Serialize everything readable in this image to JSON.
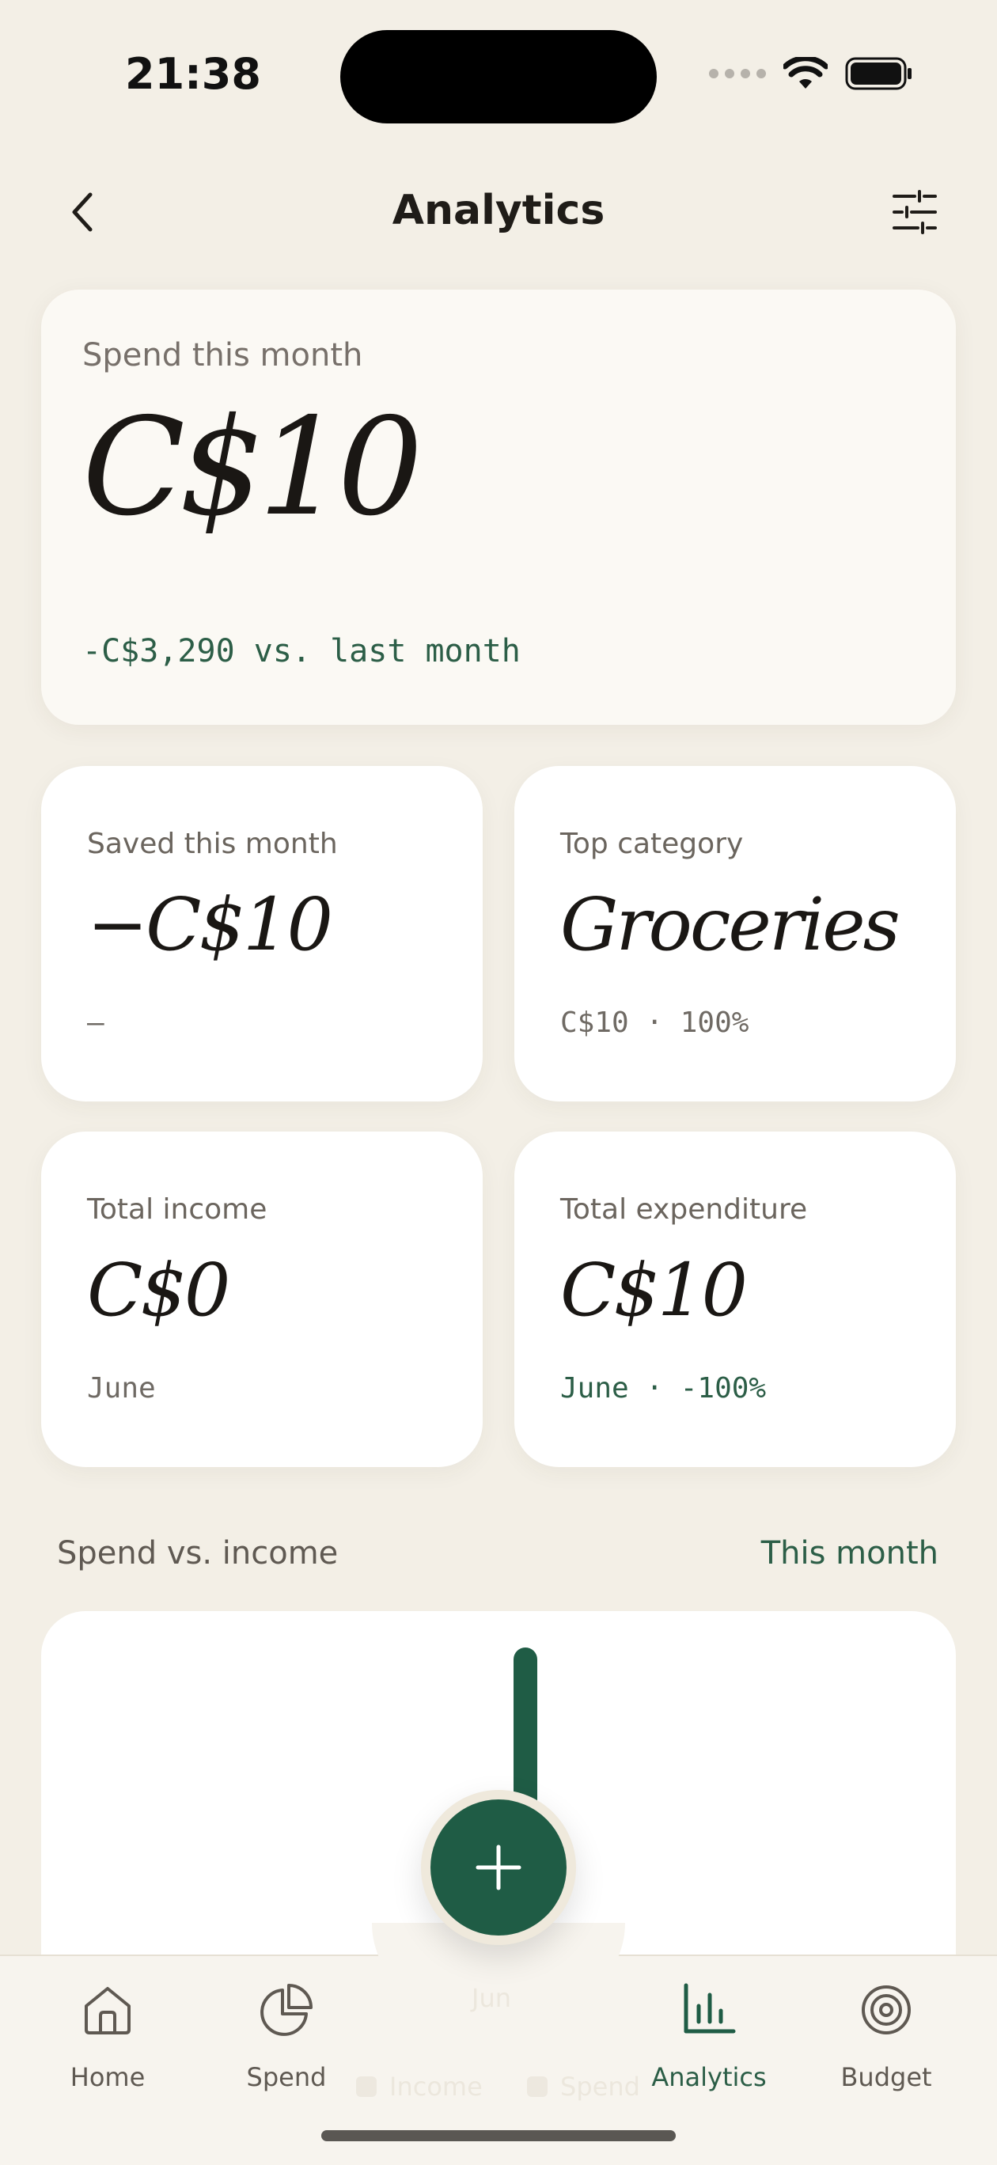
{
  "status_bar": {
    "time": "21:38"
  },
  "header": {
    "title": "Analytics"
  },
  "hero": {
    "label": "Spend this month",
    "value": "C$10",
    "delta": "-C$3,290 vs. last month"
  },
  "cards": [
    {
      "label": "Saved this month",
      "value": "−C$10",
      "sub": "–"
    },
    {
      "label": "Top category",
      "value": "Groceries",
      "sub": "C$10 · 100%"
    },
    {
      "label": "Total income",
      "value": "C$0",
      "sub": "June"
    },
    {
      "label": "Total expenditure",
      "value": "C$10",
      "sub": "June · -100%"
    }
  ],
  "section": {
    "title": "Spend vs. income",
    "period": "This month"
  },
  "chart_data": {
    "type": "bar",
    "categories": [
      "Jun"
    ],
    "series": [
      {
        "name": "Income",
        "values": [
          0
        ]
      },
      {
        "name": "Spend",
        "values": [
          10
        ]
      }
    ],
    "title": "",
    "xlabel": "",
    "ylabel": "",
    "ylim": [
      0,
      10
    ],
    "legend": "bottom",
    "colors": {
      "Spend": "#1f5c45",
      "Income": "#d9d3c7"
    }
  },
  "nav": {
    "home": "Home",
    "spend": "Spend",
    "analytics": "Analytics",
    "budget": "Budget"
  },
  "colors": {
    "accent": "#1f5c45",
    "background": "#f3efe6"
  }
}
